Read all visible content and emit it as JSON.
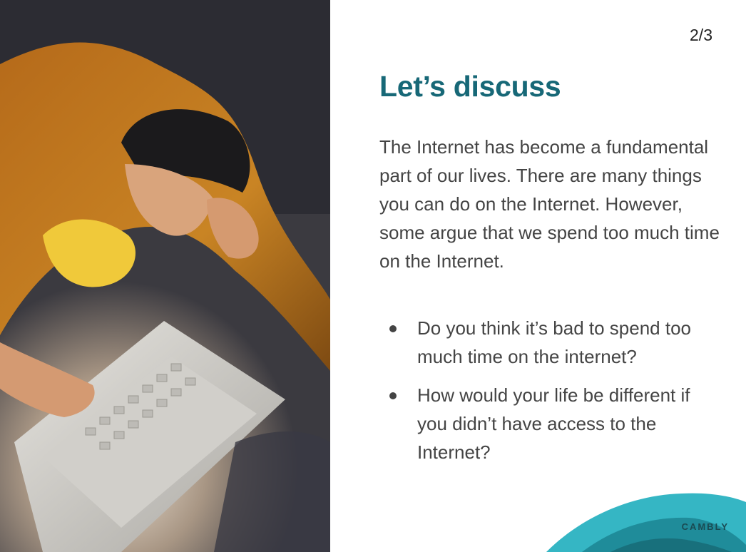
{
  "slide": {
    "page_counter": "2/3",
    "title": "Let’s discuss",
    "body": "The Internet has become a fundamental part of our lives. There are many things you can do on the Internet. However, some argue that we spend too much time on the Internet.",
    "questions": [
      "Do you think it’s bad to spend too much time on the internet?",
      "How would your life be different if you didn’t have access to the Internet?"
    ],
    "brand": "CAMBLY"
  },
  "colors": {
    "title": "#176877",
    "body_text": "#444444",
    "wave_light": "#35b6c4",
    "wave_dark": "#1f8c9a"
  }
}
